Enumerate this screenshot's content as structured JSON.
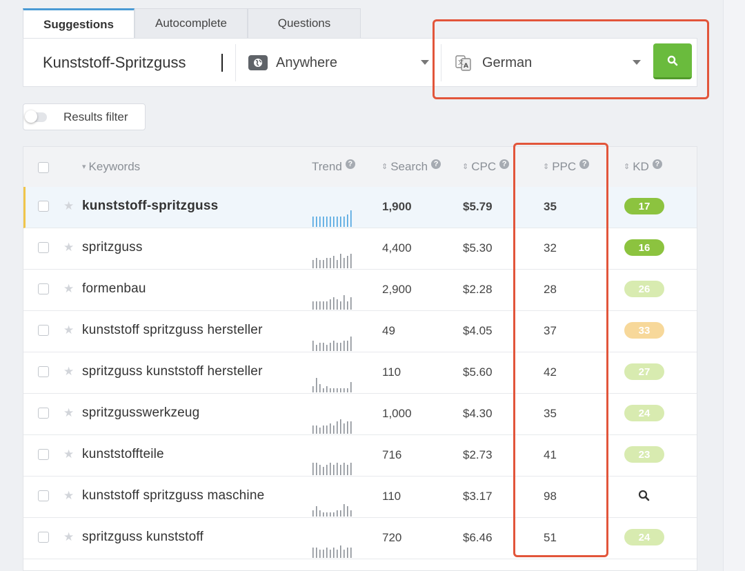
{
  "tabs": [
    {
      "label": "Suggestions",
      "active": true
    },
    {
      "label": "Autocomplete",
      "active": false
    },
    {
      "label": "Questions",
      "active": false
    }
  ],
  "search": {
    "keyword_value": "Kunststoff-Spritzguss",
    "location": "Anywhere",
    "language": "German",
    "button_icon": "search-icon"
  },
  "filter": {
    "label": "Results filter",
    "enabled": false
  },
  "table": {
    "headers": {
      "keywords": "Keywords",
      "trend": "Trend",
      "search": "Search",
      "cpc": "CPC",
      "ppc": "PPC",
      "kd": "KD"
    },
    "rows": [
      {
        "keyword": "kunststoff-spritzguss",
        "search": "1,900",
        "cpc": "$5.79",
        "ppc": "35",
        "kd": "17",
        "kd_color": "#8cc33f",
        "trend": [
          5,
          5,
          5,
          5,
          5,
          5,
          5,
          5,
          5,
          5,
          6,
          8
        ],
        "selected": true
      },
      {
        "keyword": "spritzguss",
        "search": "4,400",
        "cpc": "$5.30",
        "ppc": "32",
        "kd": "16",
        "kd_color": "#8cc33f",
        "trend": [
          4,
          5,
          4,
          4,
          5,
          5,
          6,
          4,
          7,
          5,
          6,
          7
        ],
        "selected": false
      },
      {
        "keyword": "formenbau",
        "search": "2,900",
        "cpc": "$2.28",
        "ppc": "28",
        "kd": "26",
        "kd_color": "#d8ebb0",
        "trend": [
          4,
          4,
          4,
          4,
          4,
          5,
          6,
          5,
          4,
          7,
          4,
          6
        ],
        "selected": false
      },
      {
        "keyword": "kunststoff spritzguss hersteller",
        "search": "49",
        "cpc": "$4.05",
        "ppc": "37",
        "kd": "33",
        "kd_color": "#f7d89a",
        "trend": [
          5,
          3,
          4,
          4,
          3,
          4,
          5,
          4,
          4,
          5,
          5,
          7
        ],
        "selected": false
      },
      {
        "keyword": "spritzguss kunststoff hersteller",
        "search": "110",
        "cpc": "$5.60",
        "ppc": "42",
        "kd": "27",
        "kd_color": "#d8ebb0",
        "trend": [
          3,
          7,
          4,
          2,
          3,
          2,
          2,
          2,
          2,
          2,
          2,
          5
        ],
        "selected": false
      },
      {
        "keyword": "spritzgusswerkzeug",
        "search": "1,000",
        "cpc": "$4.30",
        "ppc": "35",
        "kd": "24",
        "kd_color": "#d8ebb0",
        "trend": [
          4,
          4,
          3,
          4,
          4,
          5,
          4,
          6,
          7,
          5,
          6,
          6
        ],
        "selected": false
      },
      {
        "keyword": "kunststoffteile",
        "search": "716",
        "cpc": "$2.73",
        "ppc": "41",
        "kd": "23",
        "kd_color": "#d8ebb0",
        "trend": [
          6,
          6,
          5,
          4,
          5,
          6,
          5,
          6,
          5,
          6,
          5,
          6
        ],
        "selected": false
      },
      {
        "keyword": "kunststoff spritzguss maschine",
        "search": "110",
        "cpc": "$3.17",
        "ppc": "98",
        "kd": "",
        "kd_color": "",
        "trend": [
          3,
          5,
          3,
          2,
          2,
          2,
          2,
          3,
          3,
          6,
          5,
          3
        ],
        "selected": false
      },
      {
        "keyword": "spritzguss kunststoff",
        "search": "720",
        "cpc": "$6.46",
        "ppc": "51",
        "kd": "24",
        "kd_color": "#d8ebb0",
        "trend": [
          5,
          5,
          4,
          4,
          5,
          4,
          5,
          4,
          6,
          4,
          5,
          5
        ],
        "selected": false
      }
    ]
  },
  "colors": {
    "accent": "#4a9ad4",
    "search_button": "#6abb3d",
    "highlight": "#e2553a",
    "selected_row_marker": "#f0c54a"
  }
}
